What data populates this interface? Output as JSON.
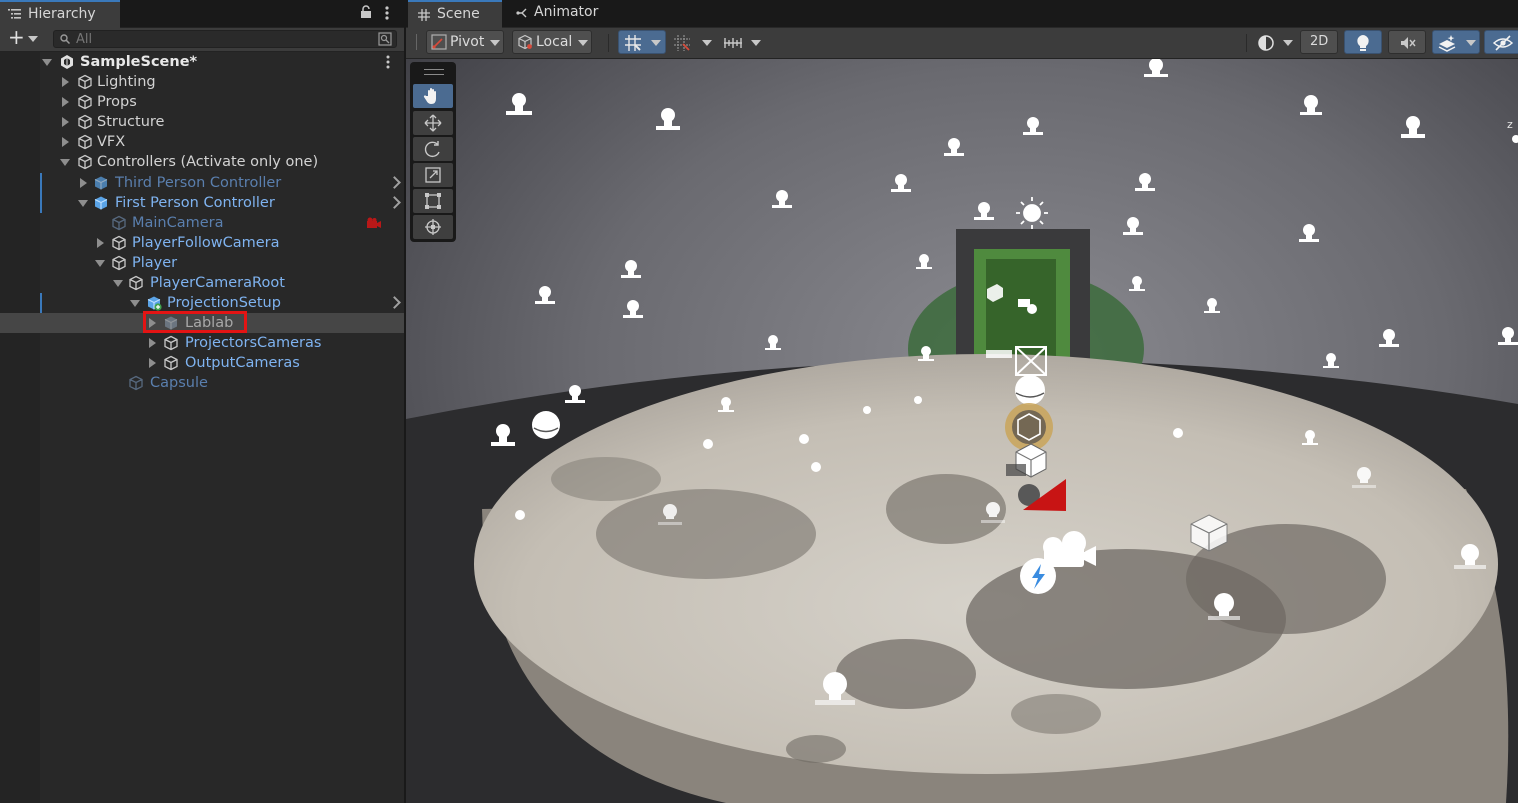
{
  "hierarchy": {
    "tab_label": "Hierarchy",
    "search_placeholder": "All",
    "rows": [
      {
        "label": "SampleScene*"
      },
      {
        "label": "Lighting"
      },
      {
        "label": "Props"
      },
      {
        "label": "Structure"
      },
      {
        "label": "VFX"
      },
      {
        "label": "Controllers (Activate only one)"
      },
      {
        "label": "Third Person Controller"
      },
      {
        "label": "First Person Controller"
      },
      {
        "label": "MainCamera"
      },
      {
        "label": "PlayerFollowCamera"
      },
      {
        "label": "Player"
      },
      {
        "label": "PlayerCameraRoot"
      },
      {
        "label": "ProjectionSetup"
      },
      {
        "label": "Lablab"
      },
      {
        "label": "ProjectorsCameras"
      },
      {
        "label": "OutputCameras"
      },
      {
        "label": "Capsule"
      }
    ]
  },
  "scene": {
    "tabs": [
      {
        "label": "Scene",
        "icon": "grid-hash-icon"
      },
      {
        "label": "Animator",
        "icon": "animator-icon"
      }
    ],
    "toolbar": {
      "pivot_label": "Pivot",
      "space_label": "Local",
      "mode_2d_label": "2D"
    },
    "tools": [
      "hand-tool",
      "move-tool",
      "rotate-tool",
      "scale-tool",
      "rect-tool",
      "transform-tool"
    ],
    "axis_label": "z"
  },
  "colors": {
    "accent_blue": "#3a79bb",
    "prefab_text": "#7fb3f0",
    "highlight_red": "#e31414",
    "camera_gizmo_red": "#c81414"
  }
}
